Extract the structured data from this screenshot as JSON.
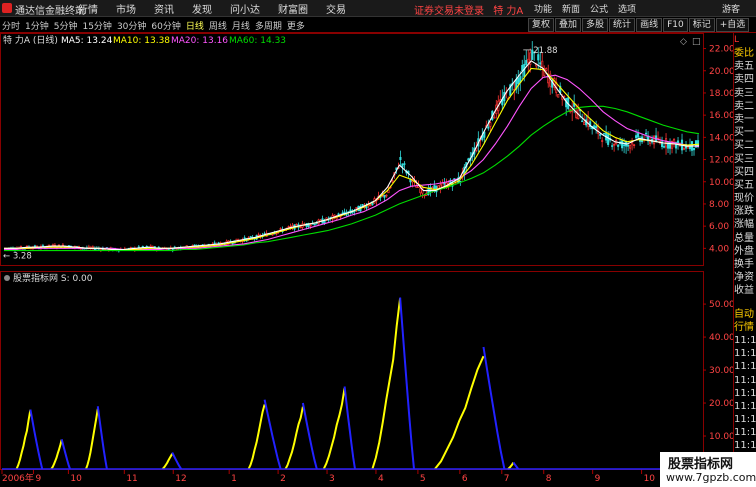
{
  "titlebar": {
    "app_name": "通达信金融终端",
    "menu": [
      "行情",
      "市场",
      "资讯",
      "发现",
      "问小达",
      "财富圈",
      "交易"
    ],
    "status_warning": "证券交易未登录",
    "stock_name": "特 力A",
    "right_menu": [
      "功能",
      "新面",
      "公式",
      "选项"
    ],
    "guest_label": "游客"
  },
  "toolbar": {
    "periods": [
      "分时",
      "1分钟",
      "5分钟",
      "15分钟",
      "30分钟",
      "60分钟",
      "日线",
      "周线",
      "月线",
      "多周期",
      "更多"
    ],
    "active_period": "日线",
    "tools": [
      "复权",
      "叠加",
      "多股",
      "统计",
      "画线",
      "F10",
      "标记",
      "+自选"
    ]
  },
  "legend": {
    "stock_label": "特 力A (日线)",
    "ma5": "MA5: 13.24",
    "ma10": "MA10: 13.38",
    "ma20": "MA20: 13.16",
    "ma60": "MA60: 14.33",
    "colors": {
      "ma5": "#ffffff",
      "ma10": "#ffff00",
      "ma20": "#ff55ff",
      "ma60": "#00dd00"
    }
  },
  "indicator": {
    "title": "股票指标网 S: 0.00",
    "high_color": "#ffff00",
    "low_color": "#2222ff"
  },
  "annotations": {
    "peak_label": "21.88",
    "low_label": "3.28"
  },
  "chart_data": [
    {
      "type": "candlestick",
      "title": "",
      "y_ticks": [
        4.0,
        6.0,
        8.0,
        10.0,
        12.0,
        14.0,
        16.0,
        18.0,
        20.0,
        22.0
      ],
      "ylim": [
        2.5,
        22.5
      ],
      "x_ticks": [
        "2006年",
        "9",
        "10",
        "11",
        "12",
        "1",
        "2",
        "3",
        "4",
        "5",
        "6",
        "7",
        "8",
        "9",
        "10",
        "11"
      ],
      "close_path": [
        4.0,
        4.0,
        4.1,
        4.1,
        4.2,
        4.2,
        4.1,
        4.0,
        4.0,
        3.9,
        3.9,
        4.0,
        4.1,
        4.0,
        4.0,
        4.1,
        4.2,
        4.3,
        4.4,
        4.6,
        4.8,
        5.0,
        5.3,
        5.6,
        5.9,
        6.1,
        6.3,
        6.6,
        7.0,
        7.3,
        7.8,
        8.3,
        9.0,
        12.0,
        10.0,
        9.0,
        9.4,
        9.8,
        10.2,
        12.5,
        14.5,
        16.5,
        18.0,
        19.5,
        21.5,
        20.0,
        18.5,
        17.0,
        16.0,
        15.0,
        14.0,
        13.5,
        13.3,
        14.0,
        13.8,
        13.5,
        13.4,
        13.2,
        13.3
      ],
      "ma60_path": [
        3.8,
        3.8,
        3.8,
        3.8,
        3.8,
        3.8,
        3.8,
        3.8,
        3.8,
        3.8,
        3.8,
        3.8,
        3.8,
        3.8,
        3.8,
        3.9,
        3.9,
        4.0,
        4.1,
        4.2,
        4.3,
        4.5,
        4.6,
        4.8,
        5.0,
        5.2,
        5.4,
        5.6,
        5.9,
        6.2,
        6.6,
        7.0,
        7.5,
        8.0,
        8.4,
        8.8,
        9.2,
        9.5,
        9.9,
        10.3,
        10.8,
        11.5,
        12.3,
        13.2,
        14.2,
        15.0,
        15.7,
        16.3,
        16.7,
        16.8,
        16.8,
        16.6,
        16.3,
        15.9,
        15.5,
        15.1,
        14.8,
        14.5,
        14.33
      ],
      "ma20_path": [
        3.9,
        3.9,
        4.0,
        4.0,
        4.0,
        4.0,
        4.0,
        4.0,
        4.0,
        4.0,
        3.9,
        3.9,
        3.9,
        3.9,
        4.0,
        4.0,
        4.0,
        4.1,
        4.2,
        4.3,
        4.4,
        4.6,
        4.8,
        5.1,
        5.4,
        5.7,
        6.0,
        6.3,
        6.6,
        7.0,
        7.3,
        7.8,
        8.4,
        9.2,
        9.6,
        9.7,
        9.8,
        10.0,
        10.3,
        11.0,
        12.0,
        13.4,
        15.0,
        16.8,
        18.4,
        19.4,
        19.6,
        19.2,
        18.4,
        17.4,
        16.3,
        15.5,
        14.8,
        14.4,
        14.0,
        13.7,
        13.5,
        13.3,
        13.16
      ],
      "ma10_path": [
        4.0,
        4.0,
        4.0,
        4.1,
        4.1,
        4.1,
        4.1,
        4.0,
        4.0,
        3.9,
        3.9,
        3.9,
        4.0,
        4.0,
        4.0,
        4.1,
        4.1,
        4.2,
        4.3,
        4.5,
        4.7,
        4.9,
        5.2,
        5.5,
        5.8,
        6.1,
        6.3,
        6.6,
        6.9,
        7.3,
        7.7,
        8.3,
        9.2,
        10.6,
        10.2,
        9.5,
        9.3,
        9.6,
        10.1,
        11.5,
        13.3,
        15.3,
        17.3,
        18.8,
        20.2,
        20.1,
        19.0,
        17.8,
        16.6,
        15.6,
        14.6,
        14.0,
        13.6,
        13.8,
        13.7,
        13.5,
        13.4,
        13.3,
        13.38
      ],
      "ma5_path": [
        4.0,
        4.0,
        4.1,
        4.1,
        4.2,
        4.2,
        4.1,
        4.0,
        4.0,
        3.9,
        3.9,
        4.0,
        4.1,
        4.0,
        4.0,
        4.1,
        4.2,
        4.3,
        4.4,
        4.6,
        4.8,
        5.0,
        5.3,
        5.6,
        5.9,
        6.1,
        6.3,
        6.6,
        7.0,
        7.3,
        7.8,
        8.3,
        9.5,
        11.5,
        10.5,
        9.2,
        9.2,
        9.7,
        10.3,
        12.2,
        14.4,
        16.4,
        18.2,
        19.6,
        20.9,
        20.2,
        18.6,
        17.1,
        16.0,
        15.0,
        14.2,
        13.6,
        13.4,
        13.9,
        13.7,
        13.5,
        13.4,
        13.2,
        13.24
      ]
    },
    {
      "type": "area",
      "title": "",
      "y_ticks": [
        10.0,
        20.0,
        30.0,
        40.0,
        50.0
      ],
      "ylim": [
        0,
        57
      ],
      "x_ticks": [
        "2006年",
        "9",
        "10",
        "11",
        "12",
        "1",
        "2",
        "3",
        "4",
        "5",
        "6",
        "7",
        "8",
        "9",
        "10",
        "11"
      ],
      "peaks": [
        {
          "start": 0.018,
          "peak": 0.038,
          "end": 0.055,
          "value": 18
        },
        {
          "start": 0.068,
          "peak": 0.083,
          "end": 0.095,
          "value": 9
        },
        {
          "start": 0.118,
          "peak": 0.135,
          "end": 0.148,
          "value": 19
        },
        {
          "start": 0.228,
          "peak": 0.242,
          "end": 0.255,
          "value": 5
        },
        {
          "start": 0.352,
          "peak": 0.375,
          "end": 0.398,
          "value": 21
        },
        {
          "start": 0.405,
          "peak": 0.43,
          "end": 0.45,
          "value": 20
        },
        {
          "start": 0.46,
          "peak": 0.49,
          "end": 0.505,
          "value": 25
        },
        {
          "start": 0.53,
          "peak": 0.57,
          "end": 0.59,
          "value": 52
        },
        {
          "start": 0.62,
          "peak": 0.69,
          "end": 0.72,
          "value": 37
        },
        {
          "start": 0.725,
          "peak": 0.733,
          "end": 0.74,
          "value": 2
        }
      ]
    }
  ],
  "right_panel": {
    "head": "L",
    "labels": [
      "委比",
      "卖五",
      "卖四",
      "卖三",
      "卖二",
      "卖一",
      "买一",
      "买二",
      "买三",
      "买四",
      "买五",
      "现价",
      "涨跌",
      "涨幅",
      "总量",
      "外盘",
      "换手",
      "净资",
      "收益"
    ],
    "lower_labels": [
      "自动",
      "行情",
      "11:1",
      "11:1",
      "11:1",
      "11:1",
      "11:1",
      "11:1",
      "11:1",
      "11:1",
      "11:1",
      "11:1",
      "11:1",
      "11:1",
      "11:1"
    ]
  },
  "watermark": {
    "line1": "股票指标网",
    "line2": "www.7gpzb.com"
  }
}
